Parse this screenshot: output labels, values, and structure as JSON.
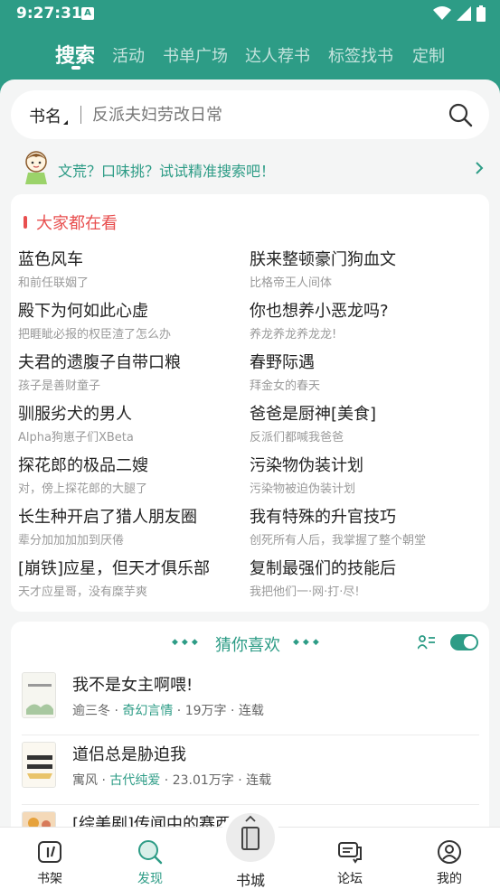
{
  "status": {
    "time": "9:27:31",
    "a_badge": "A"
  },
  "top_tabs": [
    {
      "label": "搜索",
      "active": true
    },
    {
      "label": "活动"
    },
    {
      "label": "书单广场"
    },
    {
      "label": "达人荐书"
    },
    {
      "label": "标签找书"
    },
    {
      "label": "定制"
    }
  ],
  "search": {
    "category": "书名",
    "placeholder": "反派夫妇劳改日常"
  },
  "tip": {
    "text": "文荒？口味挑？试试精准搜索吧！"
  },
  "popular": {
    "title": "大家都在看",
    "books": [
      {
        "title": "蓝色风车",
        "sub": "和前任联姻了"
      },
      {
        "title": "朕来整顿豪门狗血文",
        "sub": "比格帝王人间体"
      },
      {
        "title": "殿下为何如此心虚",
        "sub": "把睚眦必报的权臣渣了怎么办"
      },
      {
        "title": "你也想养小恶龙吗?",
        "sub": "养龙养龙养龙龙!"
      },
      {
        "title": "夫君的遗腹子自带口粮",
        "sub": "孩子是善财童子"
      },
      {
        "title": "春野际遇",
        "sub": "拜金女的春天"
      },
      {
        "title": "驯服劣犬的男人",
        "sub": "Alpha狗崽子们XBeta"
      },
      {
        "title": "爸爸是厨神[美食]",
        "sub": "反派们都喊我爸爸"
      },
      {
        "title": "探花郎的极品二嫂",
        "sub": "对，傍上探花郎的大腿了"
      },
      {
        "title": "污染物伪装计划",
        "sub": "污染物被迫伪装计划"
      },
      {
        "title": "长生种开启了猎人朋友圈",
        "sub": "辈分加加加加到厌倦"
      },
      {
        "title": "我有特殊的升官技巧",
        "sub": "创死所有人后，我掌握了整个朝堂"
      },
      {
        "title": "[崩铁]应星，但天才俱乐部",
        "sub": "天才应星哥，没有糜芋爽"
      },
      {
        "title": "复制最强们的技能后",
        "sub": "我把他们一·网·打·尽!"
      }
    ]
  },
  "guess": {
    "title": "猜你喜欢",
    "items": [
      {
        "title": "我不是女主啊喂!",
        "author": "逾三冬",
        "genre": "奇幻言情",
        "words": "19万字",
        "status": "连载"
      },
      {
        "title": "道侣总是胁迫我",
        "author": "寓风",
        "genre": "古代纯爱",
        "words": "23.01万字",
        "status": "连载"
      },
      {
        "title": "[综美剧]传闻中的赛西",
        "author": "",
        "genre": "",
        "words": "",
        "status": ""
      }
    ]
  },
  "bottom_nav": [
    {
      "label": "书架",
      "icon": "bookshelf-icon"
    },
    {
      "label": "发现",
      "icon": "discover-icon",
      "active": true
    },
    {
      "label": "书城",
      "icon": "bookstore-icon"
    },
    {
      "label": "论坛",
      "icon": "forum-icon"
    },
    {
      "label": "我的",
      "icon": "profile-icon"
    }
  ],
  "colors": {
    "accent": "#2d9c86",
    "hot": "#e84f4f"
  }
}
